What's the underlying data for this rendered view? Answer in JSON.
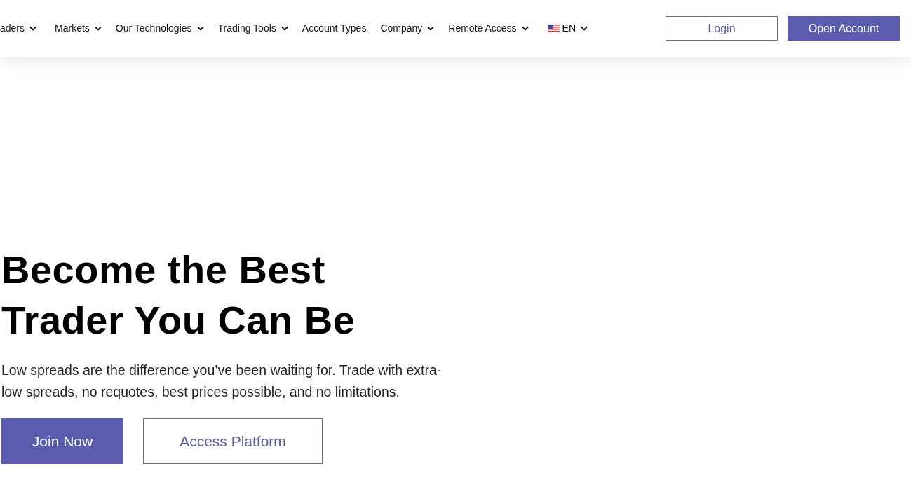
{
  "nav": {
    "items": [
      {
        "label": "aders",
        "has_menu": true
      },
      {
        "label": "Markets",
        "has_menu": true
      },
      {
        "label": "Our Technologies",
        "has_menu": true
      },
      {
        "label": "Trading Tools",
        "has_menu": true
      },
      {
        "label": "Account Types",
        "has_menu": false
      },
      {
        "label": "Company",
        "has_menu": true
      },
      {
        "label": "Remote Access",
        "has_menu": true
      }
    ],
    "language": {
      "label": "EN",
      "has_menu": true
    },
    "buttons": [
      {
        "label": "Login",
        "kind": "outline"
      },
      {
        "label": "Open Account",
        "kind": "solid"
      }
    ]
  },
  "hero": {
    "title_lines": [
      "Become the Best",
      "Trader You Can Be"
    ],
    "description": "Low spreads are the difference you’ve been waiting for. Trade with extra-low spreads, no requotes, best prices possible, and no limitations.",
    "buttons": [
      {
        "label": "Join Now",
        "kind": "solid"
      },
      {
        "label": "Access Platform",
        "kind": "outline"
      }
    ]
  }
}
